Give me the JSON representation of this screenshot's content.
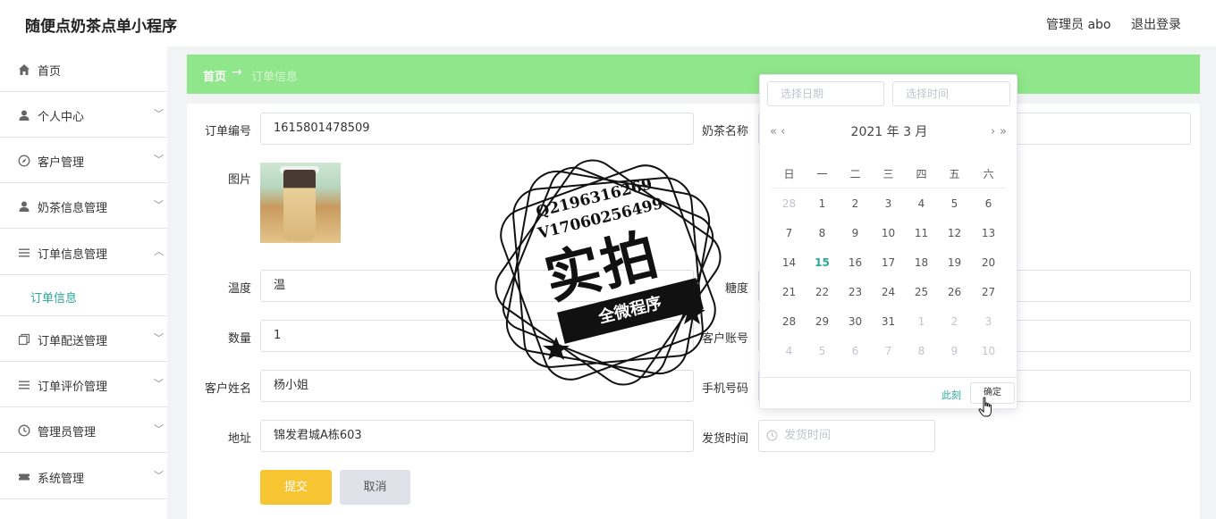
{
  "header": {
    "app_title": "随便点奶茶点单小程序",
    "admin_label": "管理员 abo",
    "logout_label": "退出登录"
  },
  "sidebar": {
    "items": [
      {
        "label": "首页",
        "icon": "home-icon"
      },
      {
        "label": "个人中心",
        "icon": "user-icon"
      },
      {
        "label": "客户管理",
        "icon": "compass-icon"
      },
      {
        "label": "奶茶信息管理",
        "icon": "user-icon"
      },
      {
        "label": "订单信息管理",
        "icon": "list-icon"
      },
      {
        "label": "订单信息",
        "icon": ""
      },
      {
        "label": "订单配送管理",
        "icon": "copy-icon"
      },
      {
        "label": "订单评价管理",
        "icon": "list-icon"
      },
      {
        "label": "管理员管理",
        "icon": "clock-icon"
      },
      {
        "label": "系统管理",
        "icon": "ticket-icon"
      }
    ]
  },
  "breadcrumb": {
    "home": "首页",
    "arrow": "→",
    "current": "订单信息"
  },
  "form": {
    "order_no_label": "订单编号",
    "order_no_value": "1615801478509",
    "tea_name_label": "奶茶名称",
    "image_label": "图片",
    "temperature_label": "温度",
    "temperature_value": "温",
    "sugar_label": "糖度",
    "quantity_label": "数量",
    "quantity_value": "1",
    "account_label": "客户账号",
    "customer_name_label": "客户姓名",
    "customer_name_value": "杨小姐",
    "phone_label": "手机号码",
    "address_label": "地址",
    "address_value": "锦发君城A栋603",
    "ship_time_label": "发货时间",
    "ship_time_placeholder": "发货时间",
    "submit_label": "提交",
    "cancel_label": "取消"
  },
  "datepicker": {
    "date_placeholder": "选择日期",
    "time_placeholder": "选择时间",
    "year_month": "2021 年  3 月",
    "prev_year": "«",
    "prev_month": "‹",
    "next_month": "›",
    "next_year": "»",
    "weekdays": [
      "日",
      "一",
      "二",
      "三",
      "四",
      "五",
      "六"
    ],
    "weeks": [
      [
        "28",
        "1",
        "2",
        "3",
        "4",
        "5",
        "6"
      ],
      [
        "7",
        "8",
        "9",
        "10",
        "11",
        "12",
        "13"
      ],
      [
        "14",
        "15",
        "16",
        "17",
        "18",
        "19",
        "20"
      ],
      [
        "21",
        "22",
        "23",
        "24",
        "25",
        "26",
        "27"
      ],
      [
        "28",
        "29",
        "30",
        "31",
        "1",
        "2",
        "3"
      ],
      [
        "4",
        "5",
        "6",
        "7",
        "8",
        "9",
        "10"
      ]
    ],
    "today": "15",
    "now_label": "此刻",
    "confirm_label": "确定"
  },
  "watermark": {
    "line1": "Q2196316269",
    "line2": "V17060256499",
    "big": "实拍",
    "banner": "全微程序"
  },
  "colors": {
    "accent": "#2aa89a",
    "breadcrumb_bg": "#90e68a",
    "submit_bg": "#f7c531",
    "cancel_bg": "#dfe2e8"
  }
}
